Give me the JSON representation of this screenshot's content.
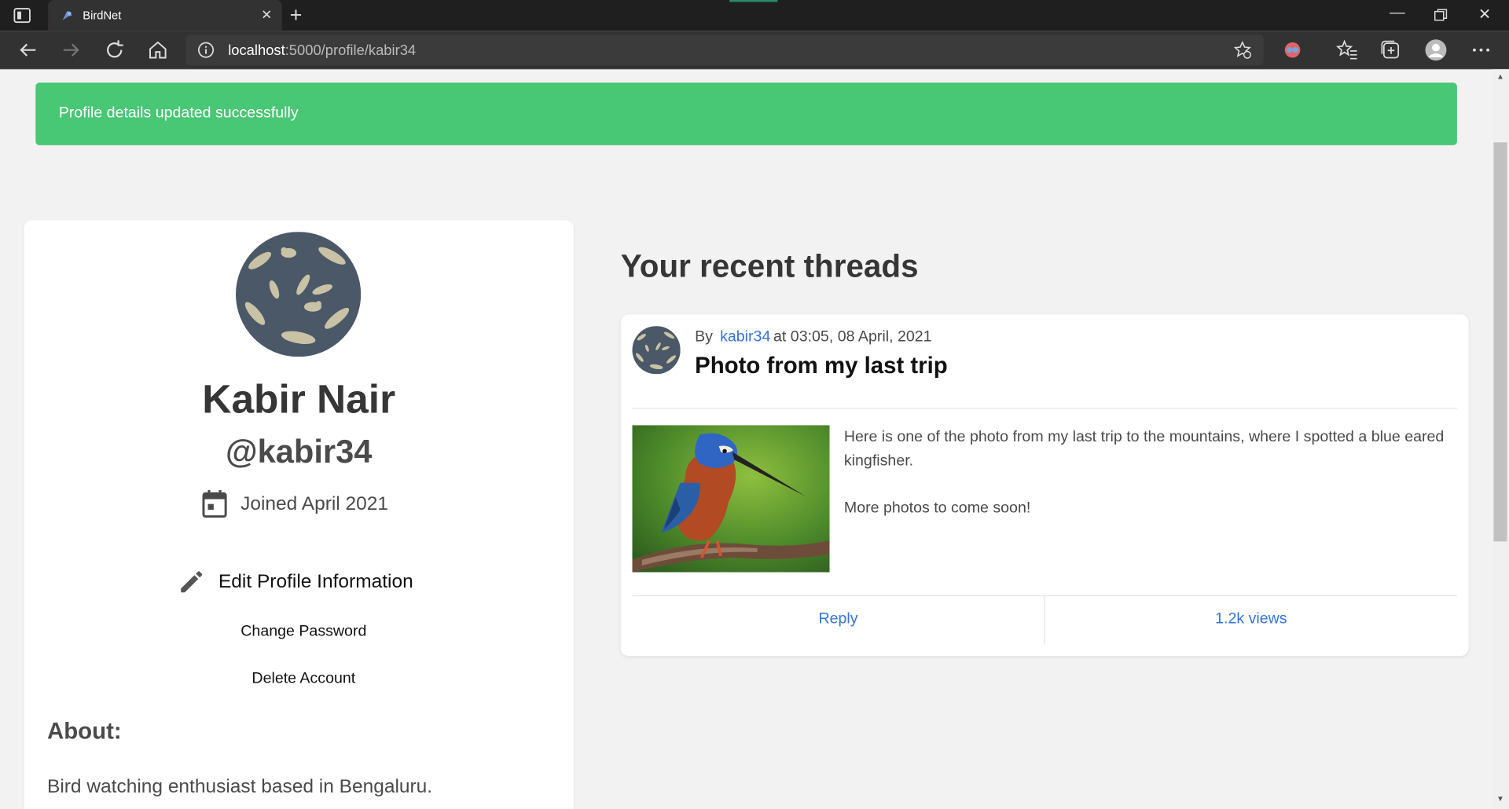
{
  "browser": {
    "tab_title": "BirdNet",
    "url_host": "localhost",
    "url_path": ":5000/profile/kabir34"
  },
  "alert": {
    "message": "Profile details updated successfully",
    "color": "#48c774"
  },
  "profile": {
    "name": "Kabir Nair",
    "handle": "@kabir34",
    "joined": "Joined April 2021",
    "edit_label": "Edit Profile Information",
    "change_password_label": "Change Password",
    "delete_account_label": "Delete Account",
    "about_heading": "About:",
    "about_text": "Bird watching enthusiast based in Bengaluru."
  },
  "threads": {
    "heading": "Your recent threads",
    "items": [
      {
        "by_prefix": "By",
        "author": "kabir34",
        "timestamp": "at 03:05, 08 April, 2021",
        "title": "Photo from my last trip",
        "body_p1": "Here is one of the photo from my last trip to the mountains, where I spotted a blue eared kingfisher.",
        "body_p2": "More photos to come soon!",
        "reply_label": "Reply",
        "views": "1.2k views"
      }
    ]
  },
  "colors": {
    "link": "#3273dc",
    "card_bg": "#ffffff",
    "page_bg": "#f2f2f2"
  }
}
